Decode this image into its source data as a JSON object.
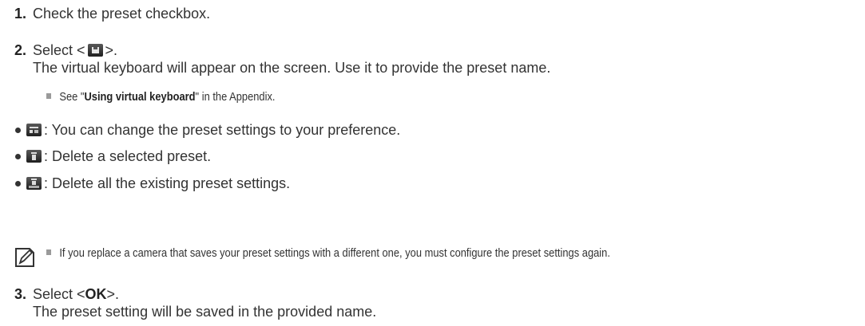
{
  "step1": {
    "number": "1.",
    "text": "Check the preset checkbox."
  },
  "step2": {
    "number": "2.",
    "select_prefix": "Select <",
    "select_suffix": ">.",
    "save_icon": "save-icon",
    "description": "The virtual keyboard will appear on the screen. Use it to provide the preset name.",
    "tip": {
      "prefix": "See \"",
      "link": "Using virtual keyboard",
      "suffix": "\" in the Appendix."
    }
  },
  "bullets": [
    {
      "icon": "preset-settings-icon",
      "text": ": You can change the preset settings to your preference."
    },
    {
      "icon": "delete-icon",
      "text": ": Delete a selected preset."
    },
    {
      "icon": "delete-all-icon",
      "text": ": Delete all the existing preset settings."
    }
  ],
  "note": {
    "icon": "note-pencil-icon",
    "text": "If you replace a camera that saves your preset settings with a different one, you must configure the preset settings again."
  },
  "step3": {
    "number": "3.",
    "select_prefix": "Select <",
    "ok_label": "OK",
    "select_suffix": ">.",
    "description": "The preset setting will be saved in the provided name."
  },
  "colors": {
    "text": "#333333",
    "bullet_square": "#9a9a9a",
    "icon_bg": "#2a2a2a"
  }
}
